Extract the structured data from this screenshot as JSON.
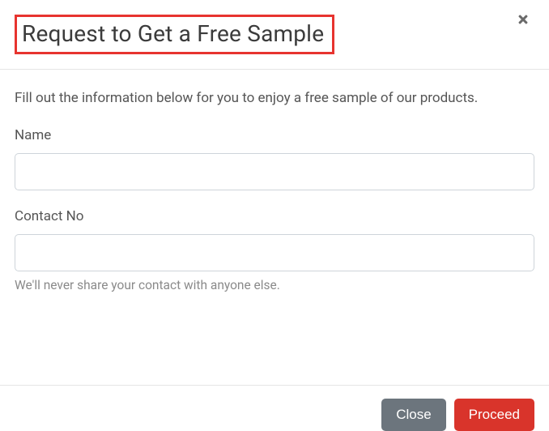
{
  "header": {
    "title": "Request to Get a Free Sample"
  },
  "body": {
    "intro": "Fill out the information below for you to enjoy a free sample of our products.",
    "name": {
      "label": "Name",
      "value": ""
    },
    "contact": {
      "label": "Contact No",
      "value": "",
      "hint": "We'll never share your contact with anyone else."
    }
  },
  "footer": {
    "close_label": "Close",
    "proceed_label": "Proceed"
  }
}
